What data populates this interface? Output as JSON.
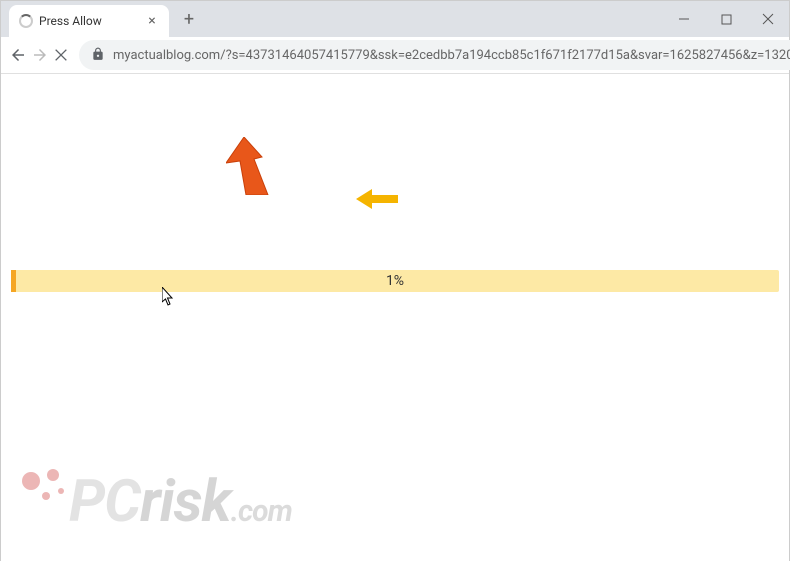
{
  "tab": {
    "title": "Press Allow"
  },
  "address": {
    "url": "myactualblog.com/?s=43731464057415779&ssk=e2cedbb7a194ccb85c1f671f2177d15a&svar=1625827456&z=132085..."
  },
  "progress": {
    "value": "1%"
  },
  "watermark": {
    "prefix": "PC",
    "main": "risk",
    "suffix": ".com"
  }
}
